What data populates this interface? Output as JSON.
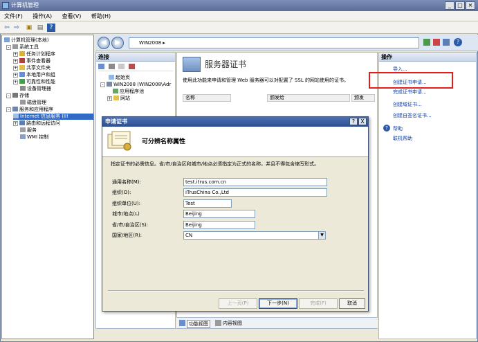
{
  "window": {
    "title": "计算机管理"
  },
  "menu": [
    "文件(F)",
    "操作(A)",
    "查看(V)",
    "帮助(H)"
  ],
  "tree": {
    "root": "计算机管理(本地)",
    "items": [
      {
        "label": "系统工具",
        "level": 1
      },
      {
        "label": "任务计划程序",
        "level": 2
      },
      {
        "label": "事件查看器",
        "level": 2
      },
      {
        "label": "共享文件夹",
        "level": 2
      },
      {
        "label": "本地用户和组",
        "level": 2
      },
      {
        "label": "可靠性和性能",
        "level": 2
      },
      {
        "label": "设备管理器",
        "level": 2
      },
      {
        "label": "存储",
        "level": 1
      },
      {
        "label": "磁盘管理",
        "level": 2
      },
      {
        "label": "服务和应用程序",
        "level": 1
      },
      {
        "label": "Internet 信息服务 (II!",
        "level": 2,
        "selected": true
      },
      {
        "label": "路由和远程访问",
        "level": 2
      },
      {
        "label": "服务",
        "level": 2
      },
      {
        "label": "WMI 控制",
        "level": 2
      }
    ]
  },
  "iis": {
    "address": "WIN2008 ▸",
    "connections": {
      "title": "连接",
      "items": [
        "起始页",
        "WIN2008 (WIN2008\\Adr",
        "应用程序池",
        "网站"
      ]
    },
    "center": {
      "title": "服务器证书",
      "description": "使用此功能来申请和管理 Web 服务器可以对配置了 SSL 的网站使用的证书。",
      "columns": [
        "名称",
        "颁发给",
        "颁发"
      ]
    },
    "bottom": {
      "features_view": "功能视图",
      "content_view": "内容视图"
    },
    "actions": {
      "title": "操作",
      "items": [
        "导入...",
        "创建证书申请...",
        "完成证书申请...",
        "创建域证书...",
        "创建自签名证书..."
      ],
      "help": "帮助",
      "online_help": "联机帮助"
    }
  },
  "dialog": {
    "title": "申请证书",
    "heading": "可分辨名称属性",
    "description": "指定证书的必需信息。省/市/自治区和城市/地点必须指定为正式的名称，并且不得包含缩写形式。",
    "fields": [
      {
        "label": "通用名称(M):",
        "value": "test.itrus.com.cn"
      },
      {
        "label": "组织(O):",
        "value": "iTrusChina Co.,Ltd"
      },
      {
        "label": "组织单位(U):",
        "value": "Test"
      },
      {
        "label": "城市/地点(L)",
        "value": "Beijing"
      },
      {
        "label": "省/市/自治区(S):",
        "value": "Beijing"
      },
      {
        "label": "国家/地区(R):",
        "value": "CN"
      }
    ],
    "buttons": {
      "prev": "上一页(P)",
      "next": "下一步(N)",
      "finish": "完成(F)",
      "cancel": "取消"
    },
    "help_btn": "?",
    "close_btn": "X"
  },
  "colors": {
    "highlight_box": "#e51c1c",
    "selection": "#316ac5",
    "link": "#0f3ea7"
  },
  "icons": [
    "app-icon",
    "back-arrow-icon",
    "forward-arrow-icon",
    "help-icon",
    "certificate-icon"
  ]
}
